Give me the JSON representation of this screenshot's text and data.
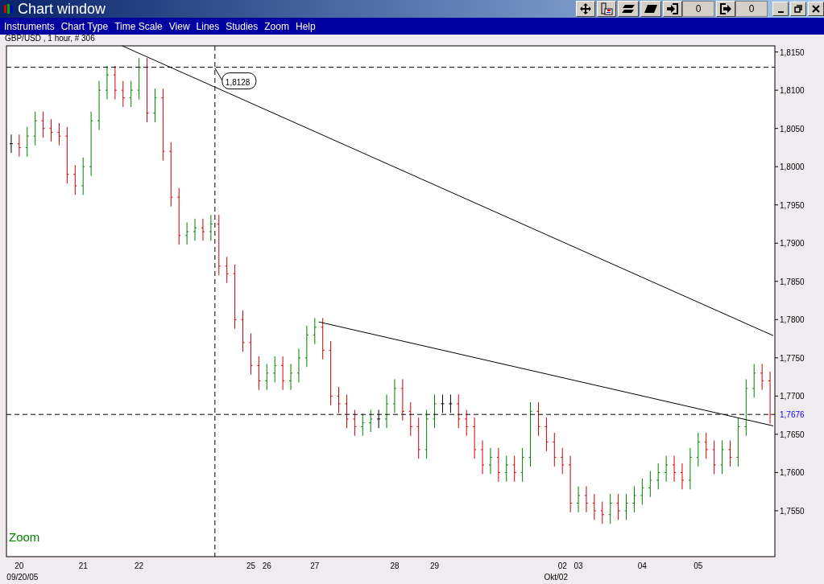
{
  "window": {
    "title": "Chart window"
  },
  "toolbar": {
    "counters": [
      "0",
      "0"
    ]
  },
  "menu": [
    "Instruments",
    "Chart Type",
    "Time Scale",
    "View",
    "Lines",
    "Studies",
    "Zoom",
    "Help"
  ],
  "chart": {
    "header": "GBP/USD , 1 hour, # 306",
    "zoom_label": "Zoom",
    "y_axis_labels": [
      "1,8150",
      "1,8100",
      "1,8050",
      "1,8000",
      "1,7950",
      "1,7900",
      "1,7850",
      "1,7800",
      "1,7750",
      "1,7700",
      "1,7650",
      "1,7600",
      "1,7550"
    ],
    "x_axis_labels": [
      "20",
      "21",
      "22",
      "25",
      "26",
      "27",
      "28",
      "29",
      "02",
      "03",
      "04",
      "05"
    ],
    "drawings": [
      {
        "kind": "trendline"
      },
      {
        "kind": "trendline"
      },
      {
        "kind": "hline"
      },
      {
        "kind": "hline",
        "label": "1,7676"
      },
      {
        "kind": "vline"
      },
      {
        "kind": "callout",
        "label": "1,8128"
      }
    ],
    "date_labels": [
      "09/20/05",
      "Okt/02"
    ]
  }
}
